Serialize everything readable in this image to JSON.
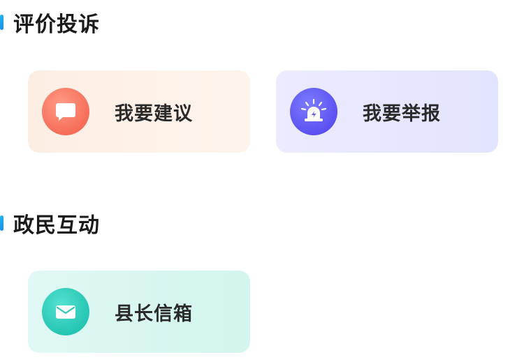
{
  "sections": [
    {
      "title": "评价投诉",
      "cards": [
        {
          "label": "我要建议",
          "icon": "chat-bubble-icon",
          "color": "#f56a55"
        },
        {
          "label": "我要举报",
          "icon": "alarm-siren-icon",
          "color": "#5a4ef0"
        }
      ]
    },
    {
      "title": "政民互动",
      "cards": [
        {
          "label": "县长信箱",
          "icon": "mail-envelope-icon",
          "color": "#22c3b2"
        }
      ]
    }
  ]
}
